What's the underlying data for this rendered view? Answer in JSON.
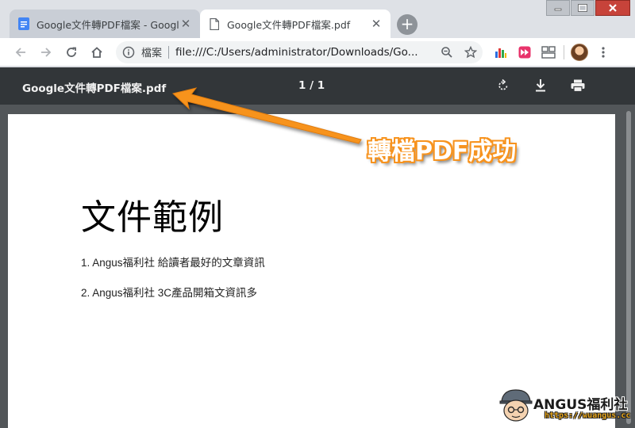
{
  "window": {
    "tabs": [
      {
        "title": "Google文件轉PDF檔案 - Google",
        "favicon": "google-docs-icon",
        "active": false
      },
      {
        "title": "Google文件轉PDF檔案.pdf",
        "favicon": "file-icon",
        "active": true
      }
    ],
    "new_tab_label": "+"
  },
  "omnibox": {
    "security_label": "檔案",
    "url": "file:///C:/Users/administrator/Downloads/Go..."
  },
  "pdf_viewer": {
    "title": "Google文件轉PDF檔案.pdf",
    "page_indicator": "1  /  1"
  },
  "document": {
    "heading": "文件範例",
    "items": [
      "1. Angus福利社 給讀者最好的文章資訊",
      "2. Angus福利社 3C產品開箱文資訊多"
    ]
  },
  "annotation": {
    "text": "轉檔PDF成功",
    "color": "#f7931e"
  },
  "watermark": {
    "name": "ANGUS福利社",
    "url": "https://wuangus.cc"
  },
  "colors": {
    "pdf_toolbar": "#323639",
    "pdf_background": "#525659",
    "tab_strip": "#dee1e6"
  }
}
